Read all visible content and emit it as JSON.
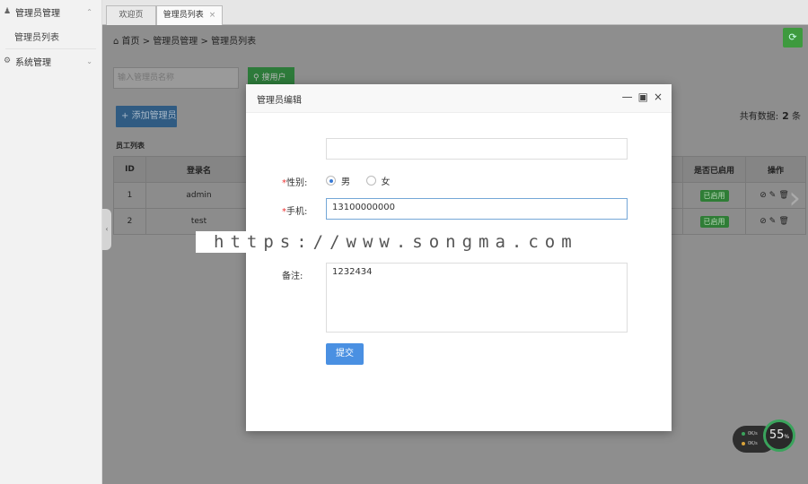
{
  "sidebar": {
    "groups": [
      {
        "label": "管理员管理",
        "items": [
          "管理员列表"
        ]
      },
      {
        "label": "系统管理",
        "items": []
      }
    ]
  },
  "tabs": [
    {
      "label": "欢迎页",
      "closable": false
    },
    {
      "label": "管理员列表",
      "closable": true
    }
  ],
  "breadcrumb": {
    "home": "首页",
    "sep": ">",
    "level1": "管理员管理",
    "level2": "管理员列表"
  },
  "search": {
    "placeholder": "输入管理员名称",
    "button": "搜用户"
  },
  "toolbar": {
    "add_label": "添加管理员"
  },
  "summary": {
    "label": "共有数据:",
    "count": "2",
    "unit": "条"
  },
  "table": {
    "title": "员工列表",
    "headers": [
      "ID",
      "登录名",
      "是否已启用",
      "操作"
    ],
    "rows": [
      {
        "id": "1",
        "login": "admin",
        "status": "已启用"
      },
      {
        "id": "2",
        "login": "test",
        "status": "已启用"
      }
    ]
  },
  "modal": {
    "title": "管理员编辑",
    "gender_label": "性别:",
    "gender_options": [
      "男",
      "女"
    ],
    "gender_selected": "男",
    "phone_label": "手机:",
    "phone_value": "13100000000",
    "remark_label": "备注:",
    "remark_value": "1232434",
    "submit_label": "提交"
  },
  "watermark": "https://www.songma.com",
  "speed_widget": {
    "percent": "55",
    "unit": "%",
    "upload": "0K/s",
    "download": "0K/s"
  },
  "colors": {
    "accent": "#4a90e2",
    "success": "#3e9a3e",
    "required": "#e33333"
  }
}
